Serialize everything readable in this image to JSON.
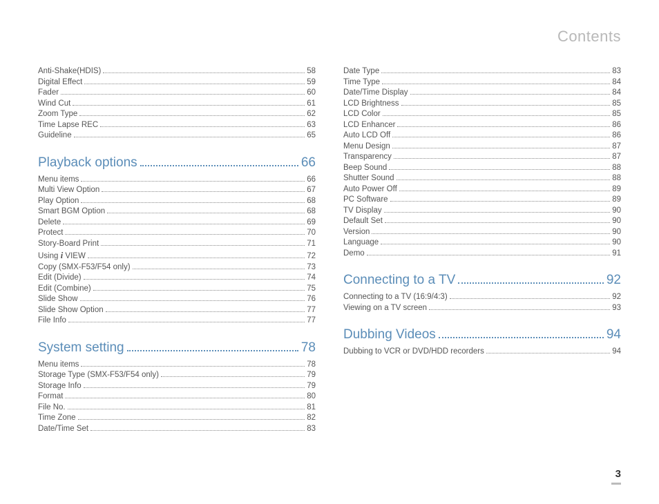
{
  "header": "Contents",
  "page_number": "3",
  "left_column": {
    "group0": [
      {
        "label": "Anti-Shake(HDIS)",
        "page": "58"
      },
      {
        "label": "Digital Effect",
        "page": "59"
      },
      {
        "label": "Fader",
        "page": "60"
      },
      {
        "label": "Wind Cut",
        "page": "61"
      },
      {
        "label": "Zoom Type",
        "page": "62"
      },
      {
        "label": "Time Lapse REC",
        "page": "63"
      },
      {
        "label": "Guideline",
        "page": "65"
      }
    ],
    "section1": {
      "label": "Playback options",
      "page": "66"
    },
    "group1": [
      {
        "label": "Menu items",
        "page": "66"
      },
      {
        "label": "Multi View Option",
        "page": "67"
      },
      {
        "label": "Play Option",
        "page": "68"
      },
      {
        "label": "Smart BGM Option",
        "page": "68"
      },
      {
        "label": "Delete",
        "page": "69"
      },
      {
        "label": "Protect",
        "page": "70"
      },
      {
        "label": "Story-Board Print",
        "page": "71"
      },
      {
        "label": "Using __IVIEW__",
        "page": "72"
      },
      {
        "label": "Copy (SMX-F53/F54 only)",
        "page": "73"
      },
      {
        "label": "Edit (Divide)",
        "page": "74"
      },
      {
        "label": "Edit (Combine)",
        "page": "75"
      },
      {
        "label": "Slide Show",
        "page": "76"
      },
      {
        "label": "Slide Show Option",
        "page": "77"
      },
      {
        "label": "File Info",
        "page": "77"
      }
    ],
    "section2": {
      "label": "System setting",
      "page": "78"
    },
    "group2": [
      {
        "label": "Menu items",
        "page": "78"
      },
      {
        "label": "Storage Type (SMX-F53/F54 only)",
        "page": "79"
      },
      {
        "label": "Storage Info",
        "page": "79"
      },
      {
        "label": "Format",
        "page": "80"
      },
      {
        "label": "File No.",
        "page": "81"
      },
      {
        "label": "Time Zone",
        "page": "82"
      },
      {
        "label": "Date/Time Set",
        "page": "83"
      }
    ]
  },
  "right_column": {
    "group0": [
      {
        "label": "Date Type",
        "page": "83"
      },
      {
        "label": "Time Type",
        "page": "84"
      },
      {
        "label": "Date/Time Display",
        "page": "84"
      },
      {
        "label": "LCD Brightness",
        "page": "85"
      },
      {
        "label": "LCD Color",
        "page": "85"
      },
      {
        "label": "LCD Enhancer",
        "page": "86"
      },
      {
        "label": "Auto LCD Off",
        "page": "86"
      },
      {
        "label": "Menu Design",
        "page": "87"
      },
      {
        "label": "Transparency",
        "page": "87"
      },
      {
        "label": "Beep Sound",
        "page": "88"
      },
      {
        "label": "Shutter Sound",
        "page": "88"
      },
      {
        "label": "Auto Power Off",
        "page": "89"
      },
      {
        "label": "PC Software",
        "page": "89"
      },
      {
        "label": "TV Display",
        "page": "90"
      },
      {
        "label": "Default Set",
        "page": "90"
      },
      {
        "label": "Version",
        "page": "90"
      },
      {
        "label": "Language",
        "page": "90"
      },
      {
        "label": "Demo",
        "page": "91"
      }
    ],
    "section1": {
      "label": "Connecting to a TV",
      "page": "92"
    },
    "group1": [
      {
        "label": "Connecting to a TV (16:9/4:3)",
        "page": "92"
      },
      {
        "label": "Viewing on a TV screen",
        "page": "93"
      }
    ],
    "section2": {
      "label": "Dubbing Videos",
      "page": "94"
    },
    "group2": [
      {
        "label": "Dubbing to VCR or DVD/HDD recorders",
        "page": "94"
      }
    ]
  }
}
